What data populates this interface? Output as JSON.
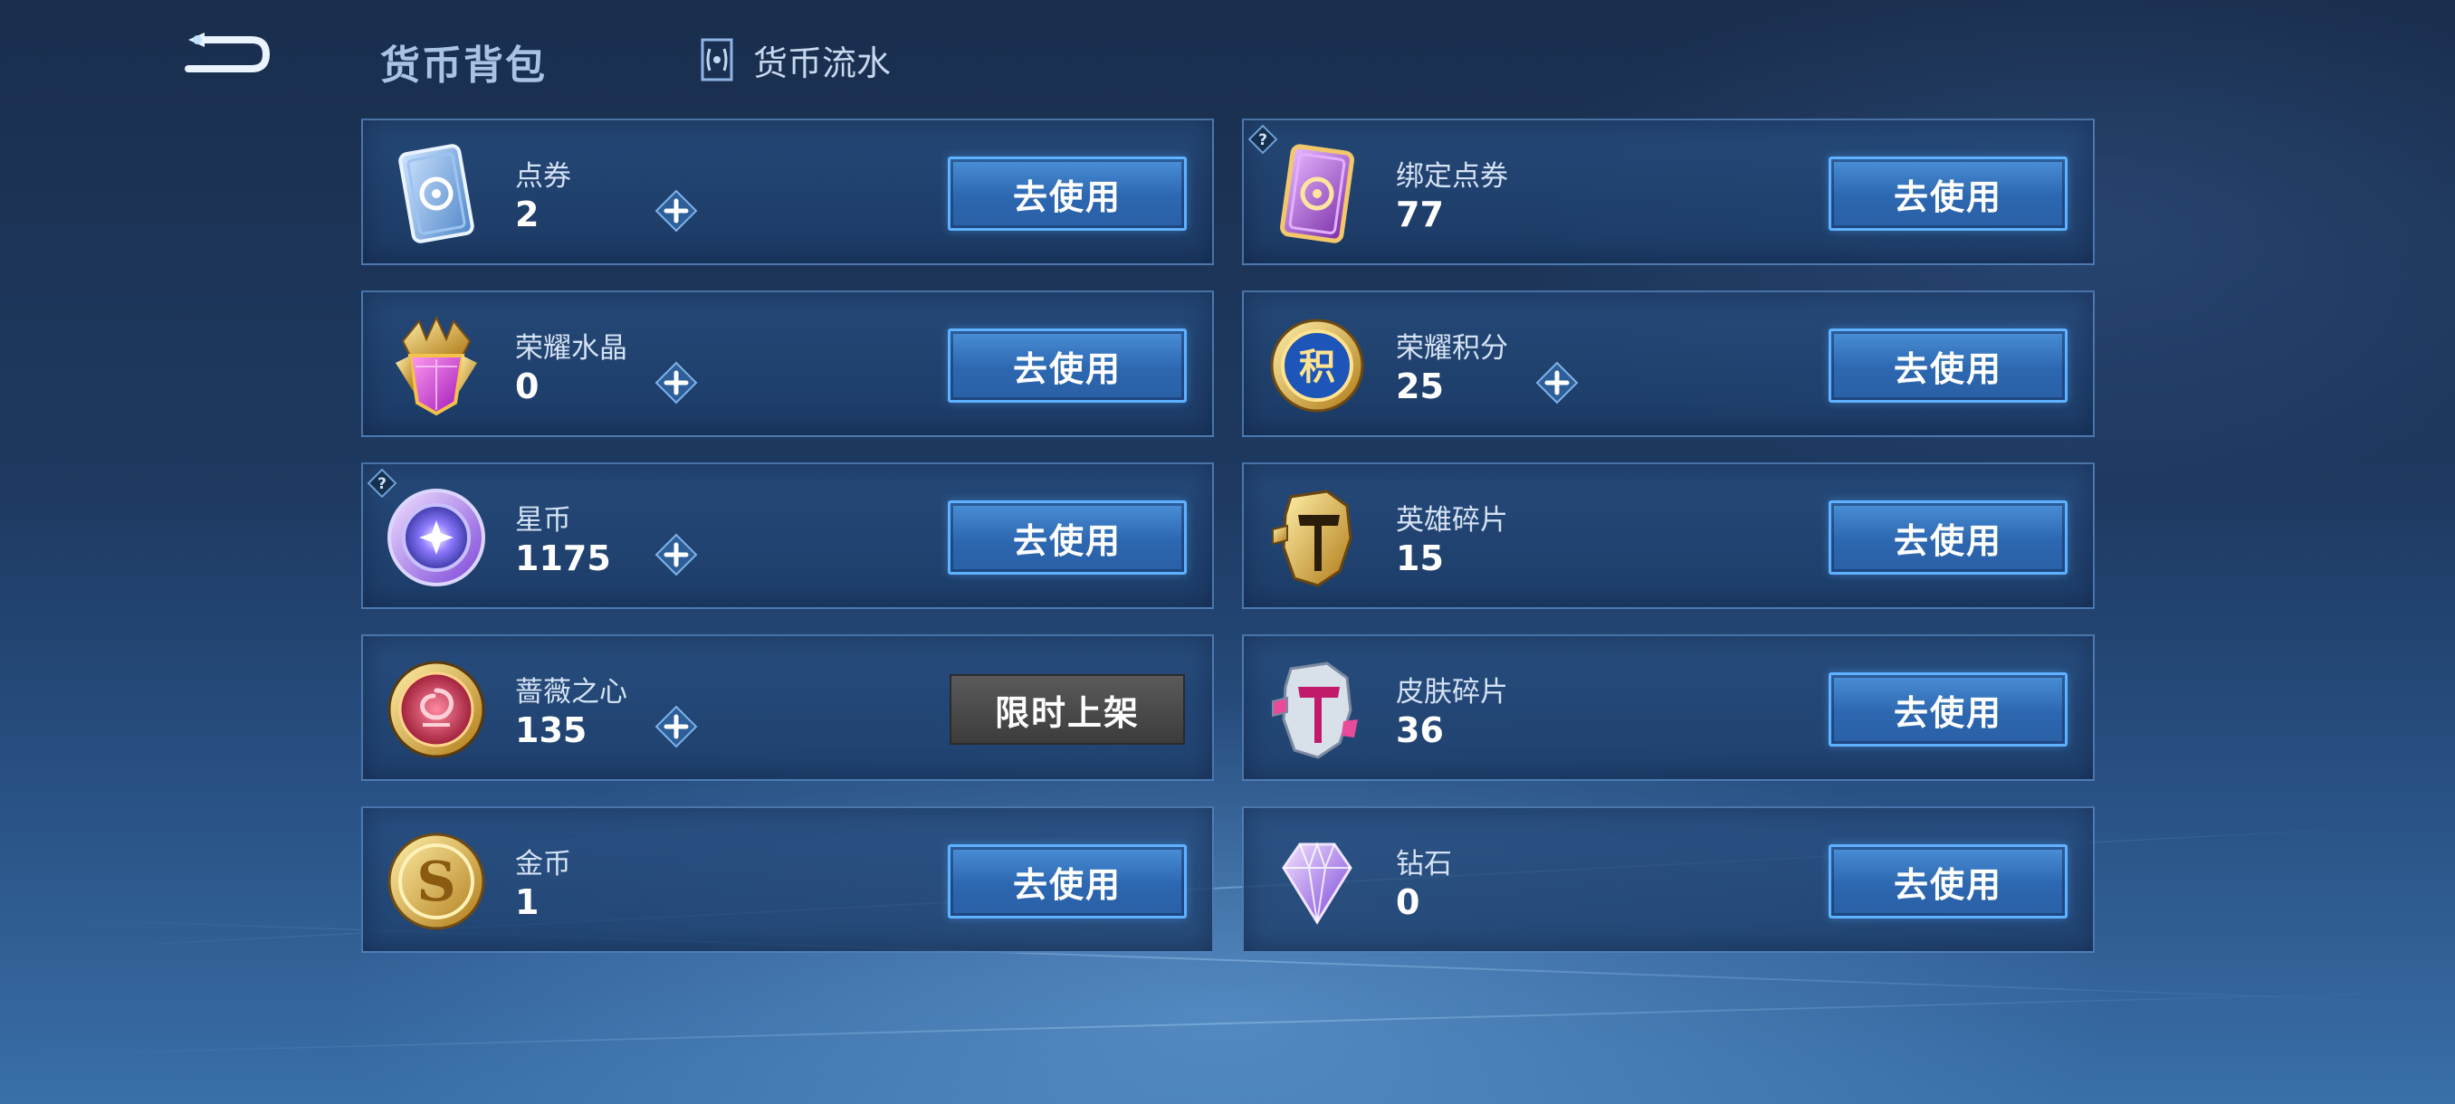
{
  "header": {
    "title": "货币背包",
    "flow_tab_label": "货币流水"
  },
  "button_labels": {
    "use": "去使用",
    "limited": "限时上架"
  },
  "currencies": [
    {
      "name": "点券",
      "amount": "2",
      "icon": "coupon-card-icon",
      "has_plus": true,
      "button": "use",
      "has_help": false
    },
    {
      "name": "绑定点券",
      "amount": "77",
      "icon": "bound-coupon-card-icon",
      "has_plus": false,
      "button": "use",
      "has_help": true
    },
    {
      "name": "荣耀水晶",
      "amount": "0",
      "icon": "glory-crystal-icon",
      "has_plus": true,
      "button": "use",
      "has_help": false
    },
    {
      "name": "荣耀积分",
      "amount": "25",
      "icon": "glory-points-icon",
      "has_plus": true,
      "button": "use",
      "has_help": false
    },
    {
      "name": "星币",
      "amount": "1175",
      "icon": "star-coin-icon",
      "has_plus": true,
      "button": "use",
      "has_help": true
    },
    {
      "name": "英雄碎片",
      "amount": "15",
      "icon": "hero-fragment-icon",
      "has_plus": false,
      "button": "use",
      "has_help": false
    },
    {
      "name": "蔷薇之心",
      "amount": "135",
      "icon": "rose-heart-icon",
      "has_plus": true,
      "button": "limited",
      "has_help": false
    },
    {
      "name": "皮肤碎片",
      "amount": "36",
      "icon": "skin-fragment-icon",
      "has_plus": false,
      "button": "use",
      "has_help": false
    },
    {
      "name": "金币",
      "amount": "1",
      "icon": "gold-coin-icon",
      "has_plus": false,
      "button": "use",
      "has_help": false
    },
    {
      "name": "钻石",
      "amount": "0",
      "icon": "diamond-icon",
      "has_plus": false,
      "button": "use",
      "has_help": false
    }
  ]
}
